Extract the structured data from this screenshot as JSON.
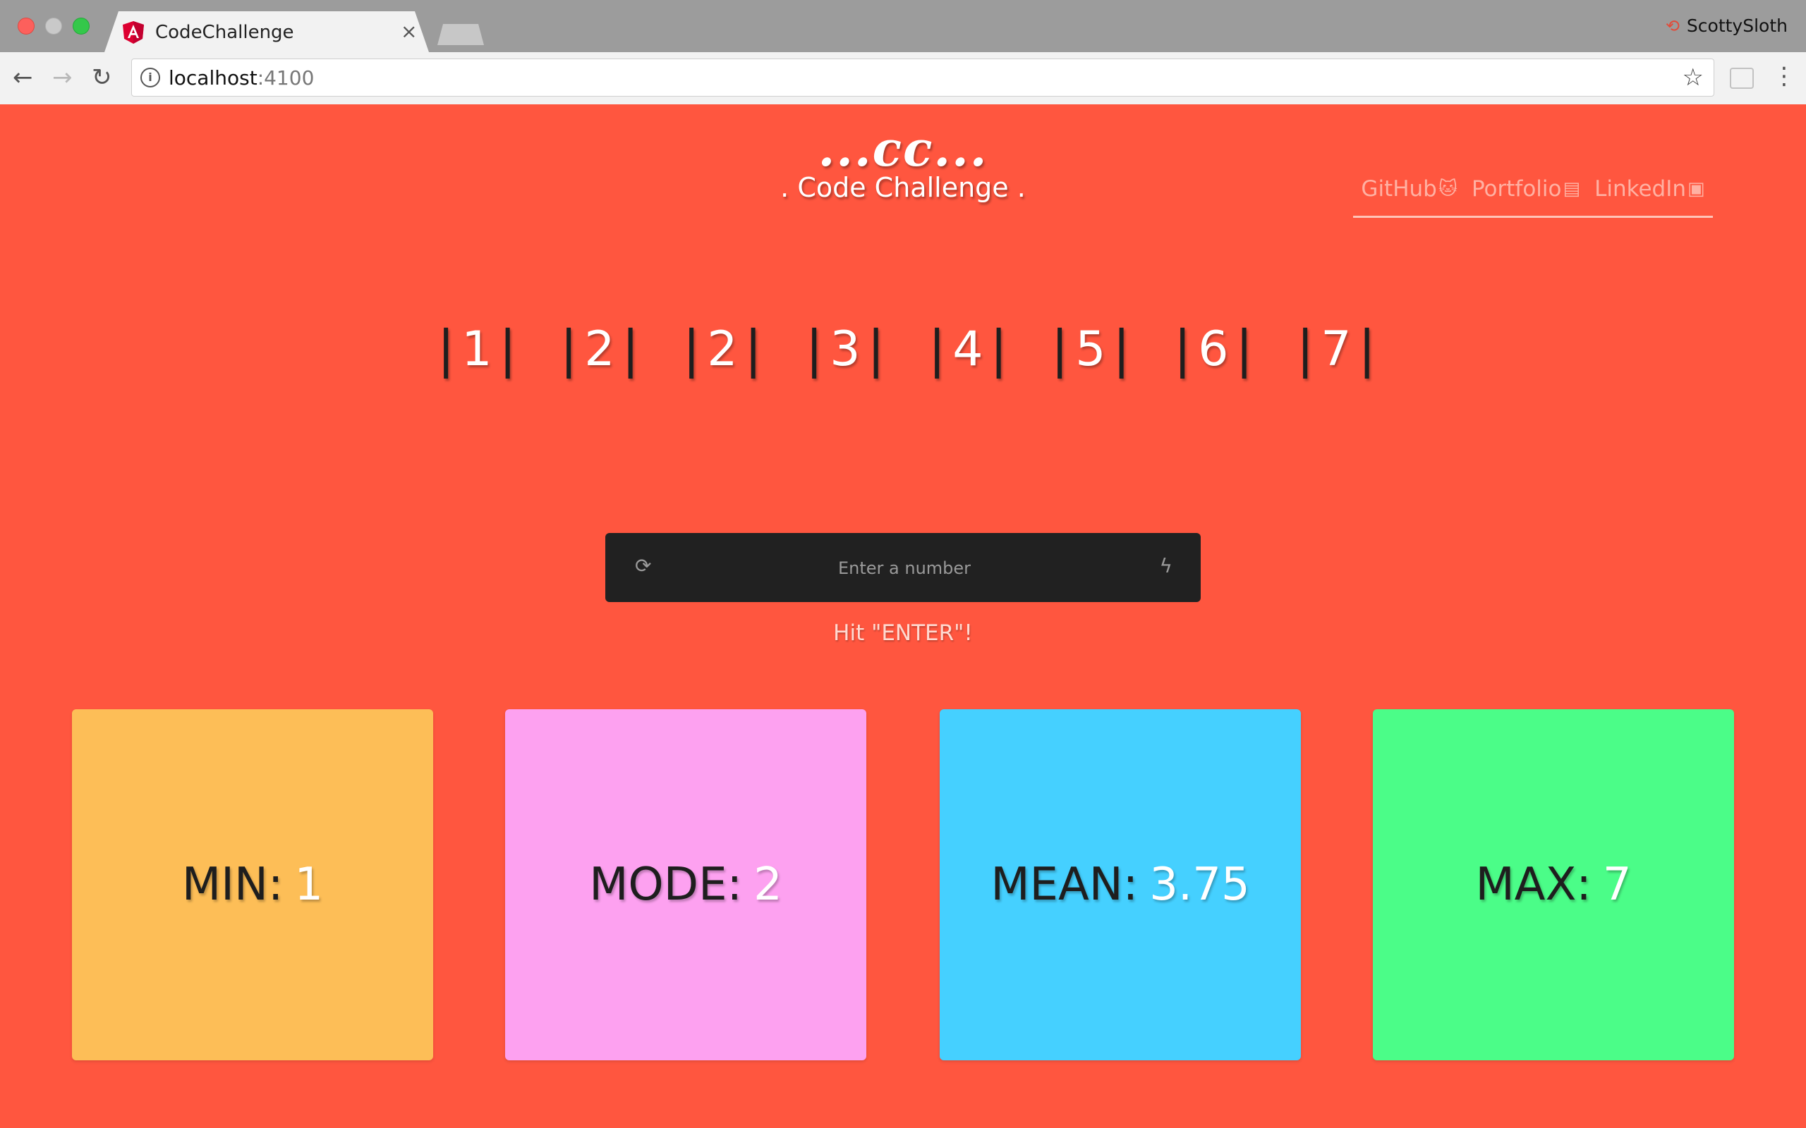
{
  "browser": {
    "tab_title": "CodeChallenge",
    "tab_close": "×",
    "profile_name": "ScottySloth",
    "url_host": "localhost",
    "url_port": ":4100"
  },
  "header": {
    "logo": "...cc...",
    "subtitle": ". Code Challenge .",
    "links": [
      {
        "label": "GitHub",
        "icon": "github-icon"
      },
      {
        "label": "Portfolio",
        "icon": "id-card-icon"
      },
      {
        "label": "LinkedIn",
        "icon": "linkedin-icon"
      }
    ]
  },
  "numbers": [
    "1",
    "2",
    "2",
    "3",
    "4",
    "5",
    "6",
    "7"
  ],
  "input": {
    "placeholder": "Enter a number",
    "value": ""
  },
  "hint": "Hit \"ENTER\"!",
  "stats": {
    "min": {
      "label": "MIN:",
      "value": "1",
      "color": "#fdbe57"
    },
    "mode": {
      "label": "MODE:",
      "value": "2",
      "color": "#fda1f0"
    },
    "mean": {
      "label": "MEAN:",
      "value": "3.75",
      "color": "#45d0ff"
    },
    "max": {
      "label": "MAX:",
      "value": "7",
      "color": "#4bfd88"
    }
  },
  "colors": {
    "page_background": "#ff563f",
    "input_background": "#212121"
  }
}
